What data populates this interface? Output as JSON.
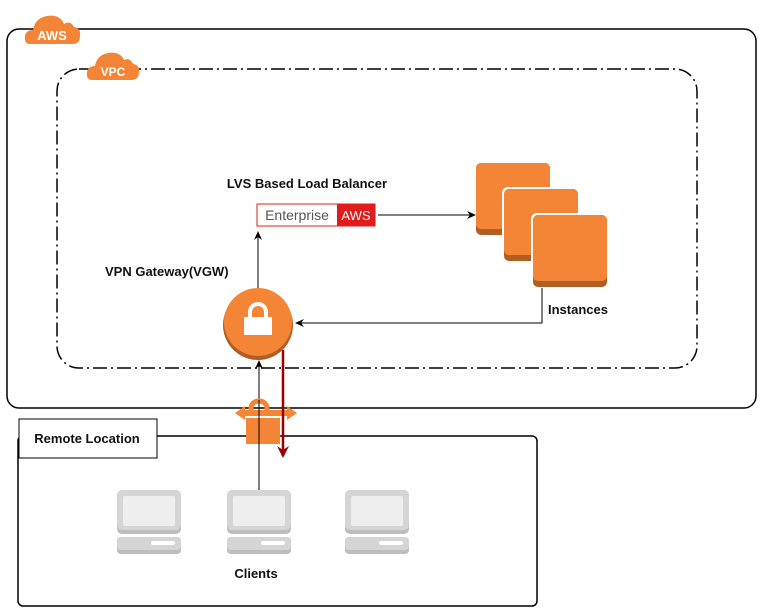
{
  "aws_group": {
    "badge": "AWS"
  },
  "vpc_group": {
    "badge": "VPC"
  },
  "load_balancer": {
    "title": "LVS Based Load Balancer",
    "logo_left": "Enterprise",
    "logo_right": "AWS"
  },
  "instances": {
    "label": "Instances"
  },
  "vpn_gateway": {
    "label": "VPN Gateway(VGW)"
  },
  "remote": {
    "label": "Remote Location"
  },
  "clients": {
    "label": "Clients",
    "count": 3
  },
  "colors": {
    "aws_orange": "#F58536",
    "orange_dark": "#B05E24",
    "enterprise_red": "#E21B1B",
    "return_line": "#990000",
    "laptop_grey": "#D5D5D5"
  }
}
